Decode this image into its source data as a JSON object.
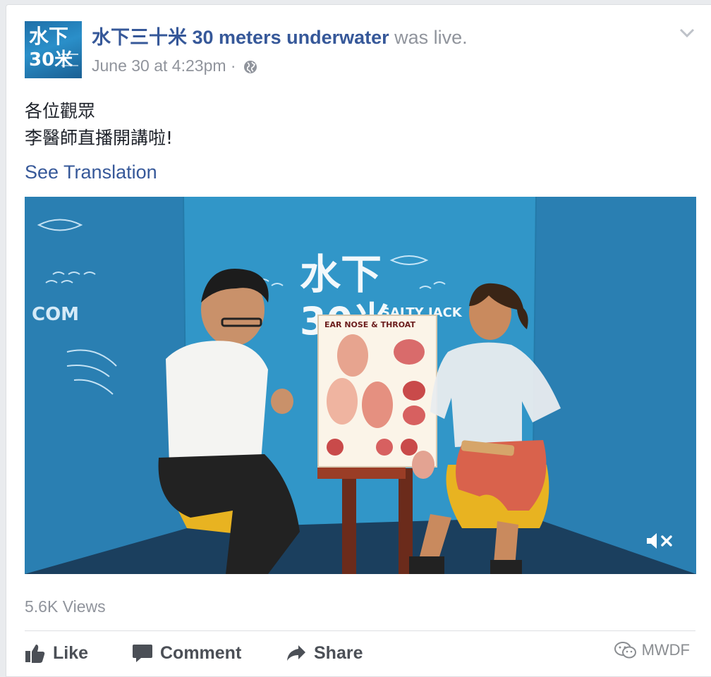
{
  "post": {
    "avatar_text_line1": "水下",
    "avatar_text_line2": "30米",
    "page_name": "水下三十米 30 meters underwater",
    "status": " was live.",
    "timestamp": "June 30 at 4:23pm",
    "separator": " · ",
    "privacy_icon": "globe-icon",
    "menu_icon": "chevron-down-icon",
    "message_line1": "各位觀眾",
    "message_line2": "李醫師直播開講啦!",
    "see_translation": "See Translation"
  },
  "video": {
    "poster_title": "EAR NOSE & THROAT",
    "wall_text_1": "水下",
    "wall_text_2": "30米",
    "wall_text_3": "SALTY JACK",
    "mute_icon": "speaker-muted-icon"
  },
  "stats": {
    "views": "5.6K Views"
  },
  "actions": {
    "like": "Like",
    "comment": "Comment",
    "share": "Share"
  },
  "watermark": {
    "text": "MWDF",
    "icon": "wechat-icon"
  },
  "colors": {
    "link": "#365899",
    "meta": "#90949c",
    "action": "#4b4f56",
    "wall": "#2b86b8"
  }
}
